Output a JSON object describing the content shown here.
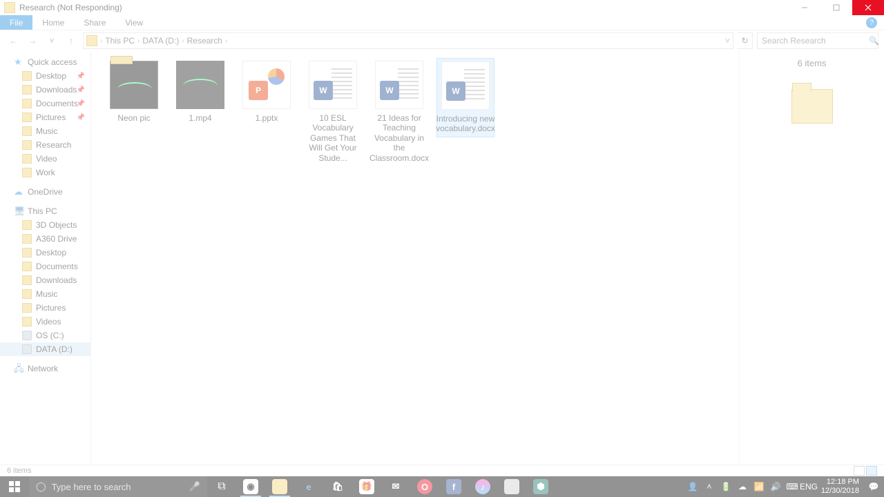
{
  "window": {
    "title": "Research (Not Responding)"
  },
  "tabs": {
    "file": "File",
    "home": "Home",
    "share": "Share",
    "view": "View"
  },
  "breadcrumb": [
    "This PC",
    "DATA (D:)",
    "Research"
  ],
  "search": {
    "placeholder": "Search Research"
  },
  "sidebar": {
    "quick": {
      "header": "Quick access",
      "items": [
        "Desktop",
        "Downloads",
        "Documents",
        "Pictures",
        "Music",
        "Research",
        "Video",
        "Work"
      ]
    },
    "onedrive": "OneDrive",
    "thispc": {
      "header": "This PC",
      "items": [
        "3D Objects",
        "A360 Drive",
        "Desktop",
        "Documents",
        "Downloads",
        "Music",
        "Pictures",
        "Videos",
        "OS (C:)",
        "DATA (D:)"
      ]
    },
    "network": "Network"
  },
  "items": [
    {
      "name": "Neon pic",
      "kind": "folder-dark"
    },
    {
      "name": "1.mp4",
      "kind": "mp4"
    },
    {
      "name": "1.pptx",
      "kind": "pptx"
    },
    {
      "name": "10 ESL Vocabulary Games That Will Get Your Stude...",
      "kind": "docx"
    },
    {
      "name": "21 Ideas for Teaching Vocabulary in the Classroom.docx",
      "kind": "docx"
    },
    {
      "name": "Introducing new vocabulary.docx",
      "kind": "docx",
      "selected": true
    }
  ],
  "preview": {
    "count_label": "6 items"
  },
  "status": {
    "text": "6 items"
  },
  "taskbar": {
    "search_placeholder": "Type here to search",
    "lang": "ENG",
    "time": "12:18 PM",
    "date": "12/30/2018"
  }
}
